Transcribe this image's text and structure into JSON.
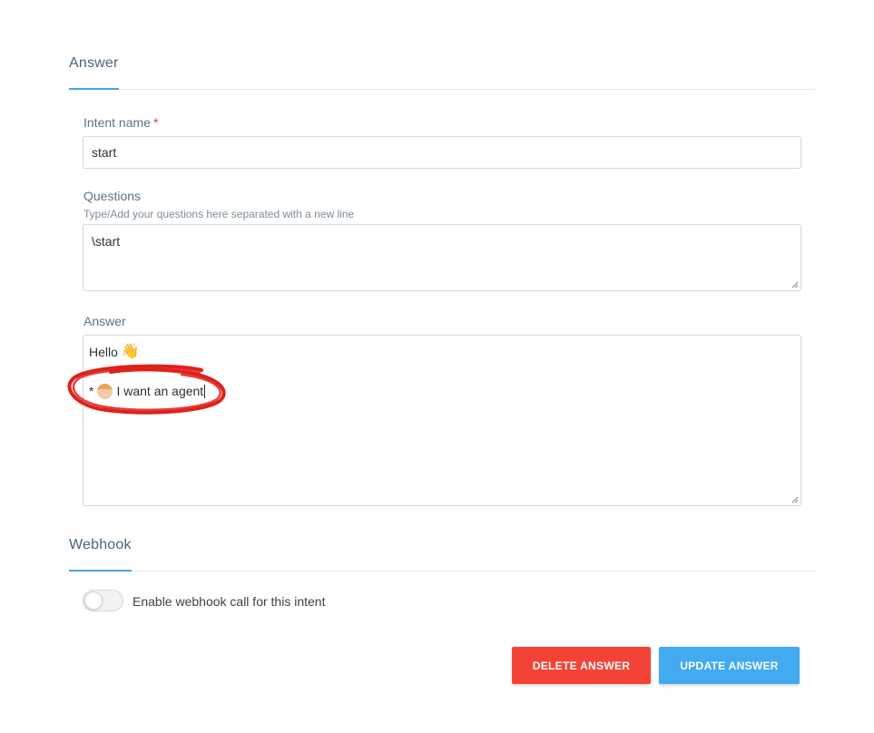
{
  "sections": {
    "answer_title": "Answer",
    "webhook_title": "Webhook"
  },
  "intent": {
    "label": "Intent name",
    "required_mark": "*",
    "value": "start"
  },
  "questions": {
    "label": "Questions",
    "hint": "Type/Add your questions here separated with a new line",
    "value": "\\start"
  },
  "answer": {
    "label": "Answer",
    "line1_text": "Hello",
    "line1_emoji": "👋",
    "line2_prefix": "*",
    "line2_text": "I want an agent"
  },
  "webhook": {
    "toggle_label": "Enable webhook call for this intent",
    "enabled": false
  },
  "buttons": {
    "delete": "DELETE ANSWER",
    "update": "UPDATE ANSWER"
  },
  "colors": {
    "accent": "#42a5e6",
    "delete": "#f44336",
    "update": "#42aaf0",
    "annotation": "#e0201b"
  }
}
